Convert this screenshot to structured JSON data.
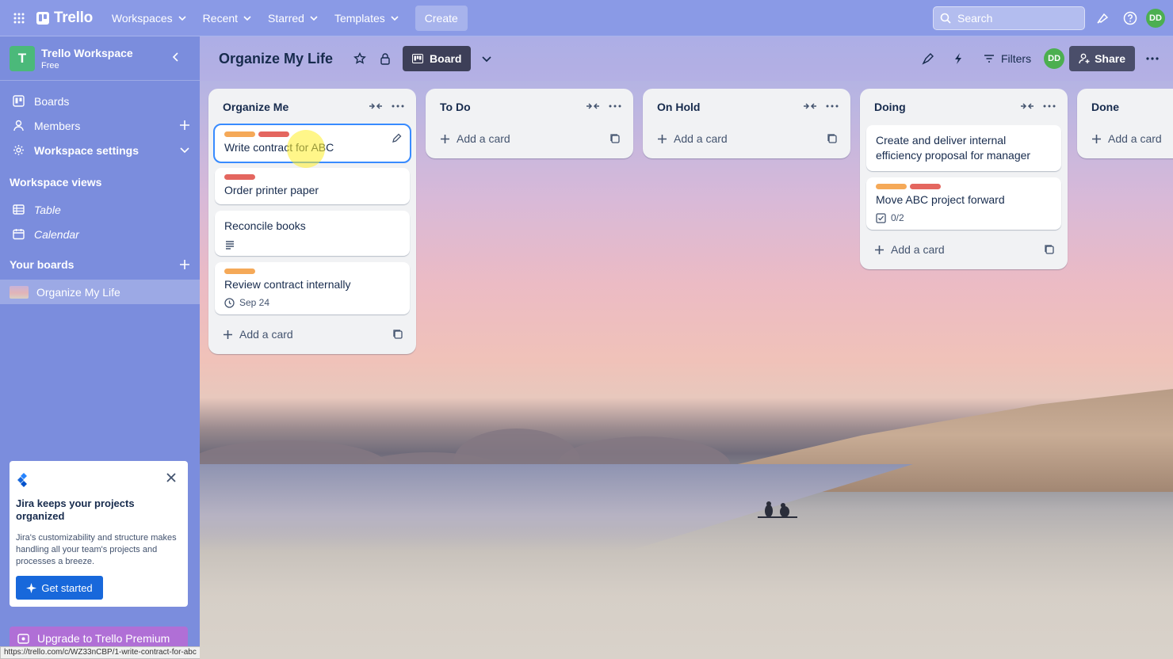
{
  "topnav": {
    "logo": "Trello",
    "menus": [
      "Workspaces",
      "Recent",
      "Starred",
      "Templates"
    ],
    "create_label": "Create",
    "search_placeholder": "Search",
    "avatar": "DD"
  },
  "sidebar": {
    "workspace_name": "Trello Workspace",
    "workspace_plan": "Free",
    "workspace_initial": "T",
    "items": {
      "boards": "Boards",
      "members": "Members",
      "settings": "Workspace settings"
    },
    "views_heading": "Workspace views",
    "views": [
      "Table",
      "Calendar"
    ],
    "your_boards_heading": "Your boards",
    "boards": [
      "Organize My Life"
    ],
    "promo": {
      "title": "Jira keeps your projects organized",
      "body": "Jira's customizability and structure makes handling all your team's projects and processes a breeze.",
      "button": "Get started"
    },
    "upgrade_label": "Upgrade to Trello Premium"
  },
  "status_url": "https://trello.com/c/WZ33nCBP/1-write-contract-for-abc",
  "board": {
    "title": "Organize My Life",
    "view_label": "Board",
    "filters_label": "Filters",
    "avatar": "DD",
    "share_label": "Share"
  },
  "lists": [
    {
      "name": "Organize Me",
      "cards": [
        {
          "title": "Write contract for ABC",
          "labels": [
            "orange",
            "red"
          ]
        },
        {
          "title": "Order printer paper",
          "labels": [
            "red"
          ]
        },
        {
          "title": "Reconcile books",
          "labels": [],
          "description_icon": "description-icon"
        },
        {
          "title": "Review contract internally",
          "labels": [
            "orange"
          ],
          "due": "Sep 24"
        }
      ],
      "add_label": "Add a card"
    },
    {
      "name": "To Do",
      "cards": [],
      "add_label": "Add a card"
    },
    {
      "name": "On Hold",
      "cards": [],
      "add_label": "Add a card"
    },
    {
      "name": "Doing",
      "cards": [
        {
          "title": "Create and deliver internal efficiency proposal for manager",
          "labels": []
        },
        {
          "title": "Move ABC project forward",
          "labels": [
            "orange",
            "red"
          ],
          "checklist": "0/2"
        }
      ],
      "add_label": "Add a card"
    },
    {
      "name": "Done",
      "cards": [],
      "add_label": "Add a card"
    }
  ],
  "colors": {
    "label_orange": "#f5a958",
    "label_red": "#e4665f",
    "nav_bg": "#8a9ae6",
    "primary_button": "#1868db"
  }
}
